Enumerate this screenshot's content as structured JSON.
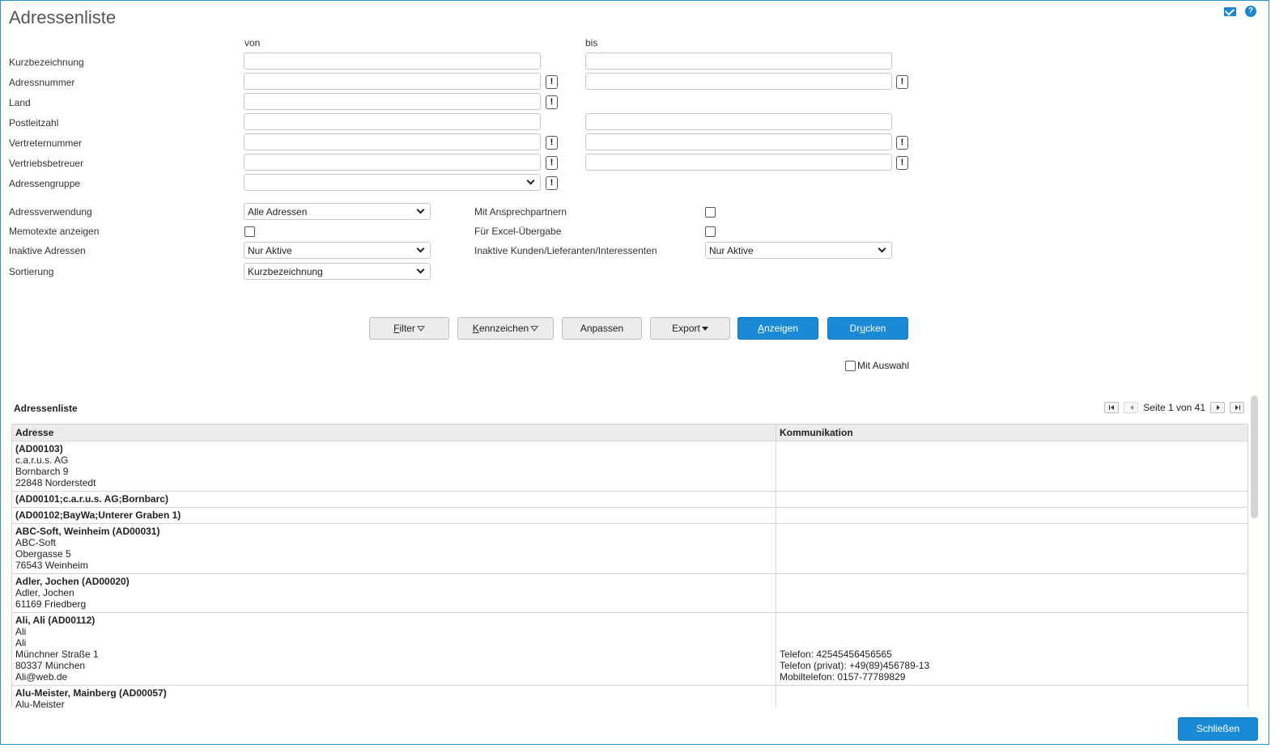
{
  "page": {
    "title": "Adressenliste"
  },
  "icons": {
    "mail": "mail-icon",
    "help": "help-icon"
  },
  "columns": {
    "from": "von",
    "to": "bis"
  },
  "range_fields": [
    {
      "label": "Kurzbezeichnung",
      "from": "",
      "to": ""
    },
    {
      "label": "Adressnummer",
      "from": "",
      "to": ""
    },
    {
      "label": "Land",
      "from": ""
    },
    {
      "label": "Postleitzahl",
      "from": "",
      "to": ""
    },
    {
      "label": "Vertreternummer",
      "from": "",
      "to": ""
    },
    {
      "label": "Vertriebsbetreuer",
      "from": "",
      "to": ""
    },
    {
      "label": "Adressengruppe",
      "from": ""
    }
  ],
  "option_button_glyph": "!",
  "options": {
    "adressverwendung": {
      "label": "Adressverwendung",
      "value": "Alle Adressen"
    },
    "memotexte": {
      "label": "Memotexte anzeigen",
      "checked": false
    },
    "inaktive_adressen": {
      "label": "Inaktive Adressen",
      "value": "Nur Aktive"
    },
    "sortierung": {
      "label": "Sortierung",
      "value": "Kurzbezeichnung"
    },
    "ansprechpartner": {
      "label": "Mit Ansprechpartnern",
      "checked": false
    },
    "excel": {
      "label": "Für Excel-Übergabe",
      "checked": false
    },
    "inaktive_kunden": {
      "label": "Inaktive Kunden/Lieferanten/Interessenten",
      "value": "Nur Aktive"
    }
  },
  "buttons": {
    "filter": {
      "label_u": "F",
      "label_rest": "ilter"
    },
    "kennzeichen": {
      "label_u": "K",
      "label_rest": "ennzeichen"
    },
    "anpassen": "Anpassen",
    "export": "Export",
    "anzeigen": {
      "label_u": "A",
      "label_rest": "nzeigen"
    },
    "drucken": {
      "label_pre": "Dr",
      "label_u": "u",
      "label_rest": "cken"
    },
    "close": "Schließen"
  },
  "mit_auswahl": {
    "label": "Mit Auswahl",
    "checked": false
  },
  "list": {
    "title": "Adressenliste",
    "pager": "Seite 1 von 41",
    "headers": [
      "Adresse",
      "Kommunikation"
    ],
    "rows": [
      {
        "address": [
          "(AD00103)",
          "c.a.r.u.s. AG",
          "Bornbarch 9",
          "22848 Norderstedt"
        ],
        "comm": []
      },
      {
        "address": [
          "(AD00101;c.a.r.u.s. AG;Bornbarc)"
        ],
        "comm": []
      },
      {
        "address": [
          "(AD00102;BayWa;Unterer Graben 1)"
        ],
        "comm": []
      },
      {
        "address": [
          "ABC-Soft, Weinheim (AD00031)",
          "ABC-Soft",
          "Obergasse 5",
          "76543 Weinheim"
        ],
        "comm": []
      },
      {
        "address": [
          "Adler, Jochen (AD00020)",
          "Adler, Jochen",
          "61169 Friedberg"
        ],
        "comm": []
      },
      {
        "address": [
          "Ali, Ali (AD00112)",
          "Ali",
          "Ali",
          "Münchner Straße 1",
          "80337 München",
          "Ali@web.de"
        ],
        "comm": [
          "Telefon: 42545456456565",
          "Telefon (privat): +49(89)456789-13",
          "Mobiltelefon: 0157-77789829"
        ]
      },
      {
        "address": [
          "Alu-Meister, Mainberg (AD00057)",
          "Alu-Meister"
        ],
        "comm": []
      }
    ]
  }
}
